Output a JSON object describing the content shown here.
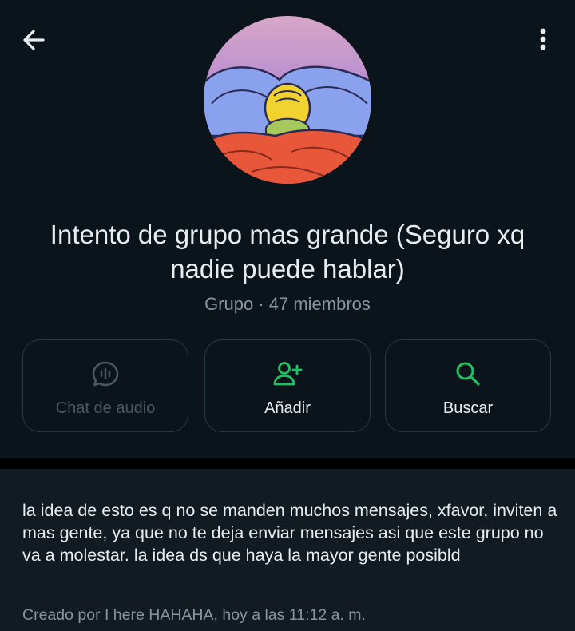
{
  "header": {
    "back_icon": "arrow-left-icon",
    "menu_icon": "more-vertical-icon"
  },
  "group": {
    "title": "Intento de grupo mas grande (Seguro xq nadie puede hablar)",
    "subtitle": "Grupo · 47 miembros"
  },
  "actions": [
    {
      "label": "Chat de audio",
      "icon": "audio-chat-icon",
      "enabled": false
    },
    {
      "label": "Añadir",
      "icon": "add-person-icon",
      "enabled": true
    },
    {
      "label": "Buscar",
      "icon": "search-icon",
      "enabled": true
    }
  ],
  "description": {
    "text": "la idea de esto es q no se manden muchos mensajes, xfavor, inviten a mas gente, ya que no te deja enviar mensajes asi que este grupo no va a molestar. la idea ds que haya la mayor gente posibld",
    "created": "Creado por I here HAHAHA, hoy a las 11:12 a. m."
  },
  "colors": {
    "background": "#0b141a",
    "panel": "#111b21",
    "accent_green": "#21c063",
    "muted_text": "#8696a0"
  }
}
